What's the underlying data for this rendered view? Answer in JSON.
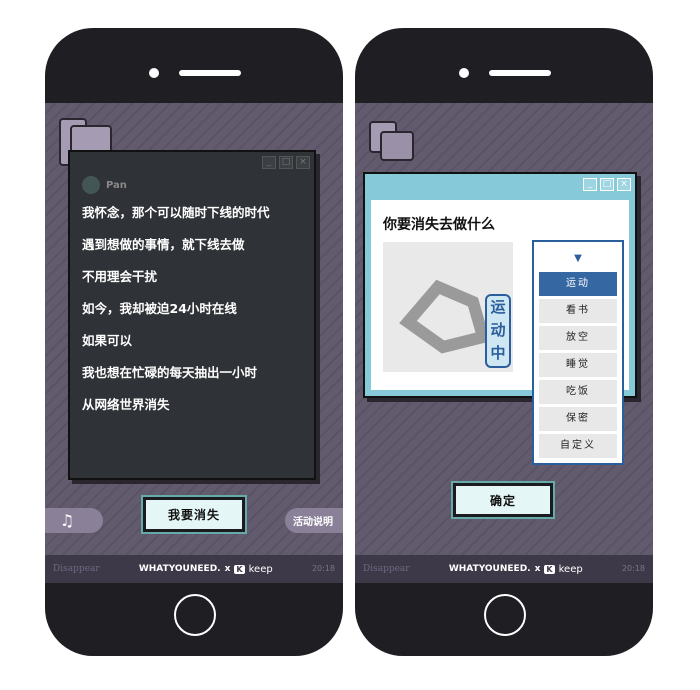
{
  "left": {
    "chat_name": "Pan",
    "poem": [
      "我怀念，那个可以随时下线的时代",
      "遇到想做的事情，就下线去做",
      "不用理会干扰",
      "如今，我却被迫24小时在线",
      "如果可以",
      "我也想在忙碌的每天抽出一小时",
      "从网络世界消失"
    ],
    "main_button": "我要消失",
    "music_icon": "♫",
    "info_button": "活动说明"
  },
  "right": {
    "question": "你要消失去做什么",
    "image_tag": "运动中",
    "dropdown_arrow": "▼",
    "options": [
      "运动",
      "看书",
      "放空",
      "睡觉",
      "吃饭",
      "保密",
      "自定义"
    ],
    "selected": "运动",
    "confirm_button": "确定"
  },
  "footer": {
    "left_text": "Disappear",
    "brand": "WHATYOUNEED.",
    "x": "x",
    "keep_icon": "K",
    "keep": "keep",
    "time": "20:18"
  },
  "window_controls": [
    "_",
    "□",
    "×"
  ],
  "colors": {
    "accent": "#3567a3",
    "titlebar": "#86c9d8",
    "screen": "#625b6d"
  }
}
